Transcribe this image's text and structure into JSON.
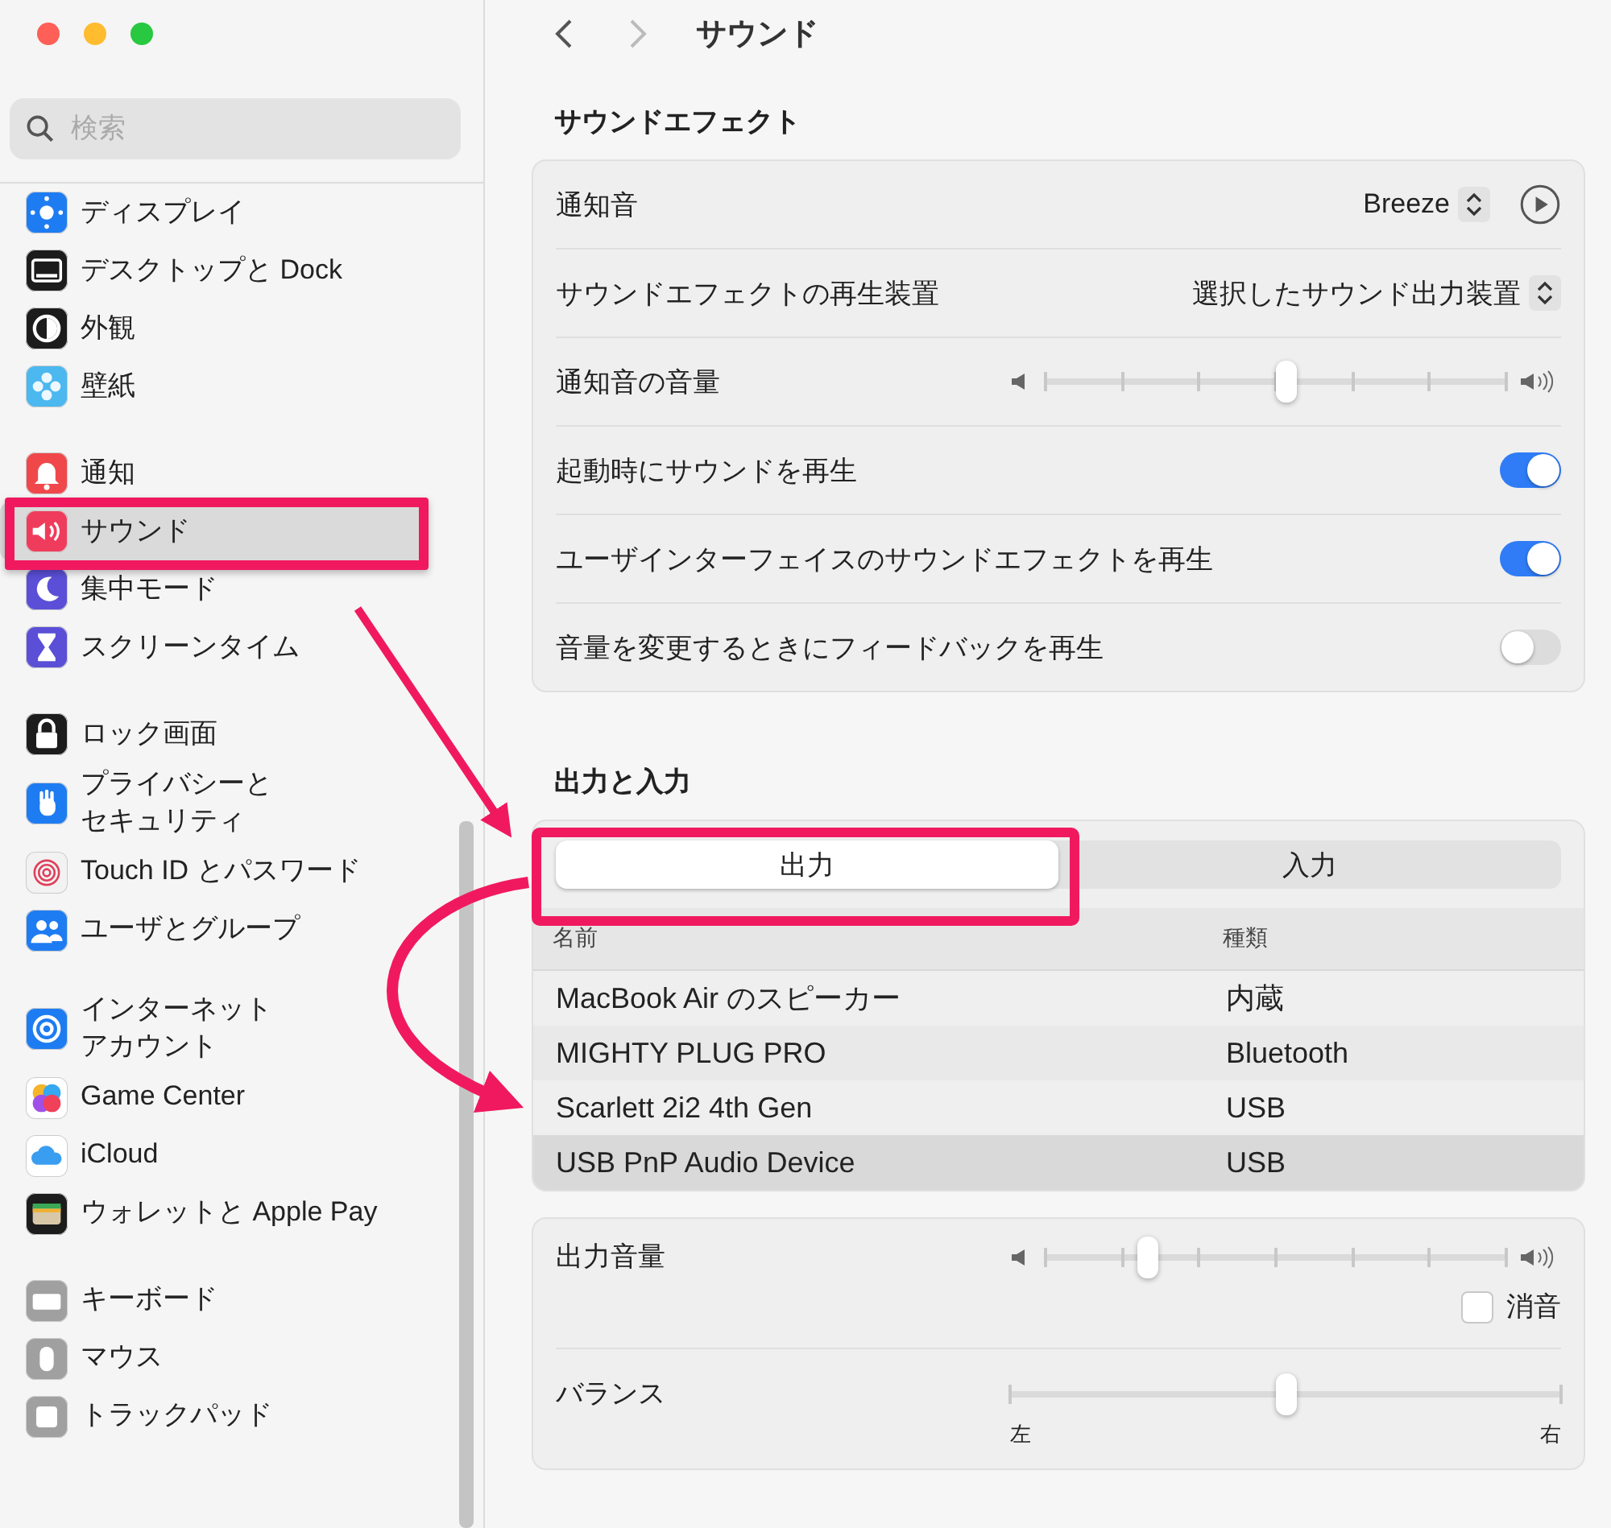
{
  "sidebar": {
    "search": {
      "placeholder": "検索"
    },
    "groups": [
      {
        "items": [
          {
            "label": "ディスプレイ",
            "selected": false,
            "color": "#1e7cf2"
          },
          {
            "label": "デスクトップと Dock",
            "selected": false,
            "color": "#1c1c1c"
          },
          {
            "label": "外観",
            "selected": false,
            "color": "#1c1c1c"
          },
          {
            "label": "壁紙",
            "selected": false,
            "color": "#4bb8f0"
          }
        ]
      },
      {
        "items": [
          {
            "label": "通知",
            "selected": false,
            "color": "#f0484a"
          },
          {
            "label": "サウンド",
            "selected": true,
            "color": "#f03c5c"
          },
          {
            "label": "集中モード",
            "selected": false,
            "color": "#5a4fd6"
          },
          {
            "label": "スクリーンタイム",
            "selected": false,
            "color": "#5a4fd6"
          }
        ]
      },
      {
        "items": [
          {
            "label": "ロック画面",
            "selected": false,
            "color": "#1c1c1c"
          },
          {
            "lines": [
              "プライバシーと",
              "セキュリティ"
            ],
            "selected": false,
            "color": "#1e7cf2"
          },
          {
            "label": "Touch ID とパスワード",
            "selected": false,
            "color": "#f2f2f2"
          },
          {
            "label": "ユーザとグループ",
            "selected": false,
            "color": "#1e7cf2"
          }
        ]
      },
      {
        "items": [
          {
            "lines": [
              "インターネット",
              "アカウント"
            ],
            "selected": false,
            "color": "#1e7cf2"
          },
          {
            "label": "Game Center",
            "selected": false,
            "color": "#ffffff"
          },
          {
            "label": "iCloud",
            "selected": false,
            "color": "#ffffff"
          },
          {
            "label": "ウォレットと Apple Pay",
            "selected": false,
            "color": "#1c1c1c"
          }
        ]
      },
      {
        "items": [
          {
            "label": "キーボード",
            "selected": false,
            "color": "#a0a0a0"
          },
          {
            "label": "マウス",
            "selected": false,
            "color": "#a0a0a0"
          },
          {
            "label": "トラックパッド",
            "selected": false,
            "color": "#a0a0a0"
          }
        ]
      }
    ]
  },
  "header": {
    "title": "サウンド"
  },
  "effects": {
    "title": "サウンドエフェクト",
    "rows": [
      {
        "kind": "popup_play",
        "label": "通知音",
        "value": "Breeze"
      },
      {
        "kind": "popup",
        "label": "サウンドエフェクトの再生装置",
        "value": "選択したサウンド出力装置"
      },
      {
        "kind": "slider",
        "label": "通知音の音量",
        "level": 0.52
      },
      {
        "kind": "toggle",
        "label": "起動時にサウンドを再生",
        "on": true
      },
      {
        "kind": "toggle",
        "label": "ユーザインターフェイスのサウンドエフェクトを再生",
        "on": true
      },
      {
        "kind": "toggle",
        "label": "音量を変更するときにフィードバックを再生",
        "on": false
      }
    ]
  },
  "output_input": {
    "title": "出力と入力",
    "tabs": [
      {
        "label": "出力",
        "selected": true
      },
      {
        "label": "入力",
        "selected": false
      }
    ],
    "table": {
      "columns": [
        "名前",
        "種類"
      ],
      "rows": [
        {
          "name": "MacBook Air のスピーカー",
          "type": "内蔵",
          "selected": false
        },
        {
          "name": "MIGHTY PLUG PRO",
          "type": "Bluetooth",
          "selected": false
        },
        {
          "name": "Scarlett 2i2 4th Gen",
          "type": "USB",
          "selected": false
        },
        {
          "name": "USB PnP Audio Device",
          "type": "USB",
          "selected": true
        }
      ]
    }
  },
  "volume": {
    "output": {
      "label": "出力音量",
      "level": 0.22
    },
    "mute": {
      "label": "消音",
      "checked": false
    },
    "balance": {
      "label": "バランス",
      "level": 0.5,
      "left": "左",
      "right": "右"
    }
  }
}
